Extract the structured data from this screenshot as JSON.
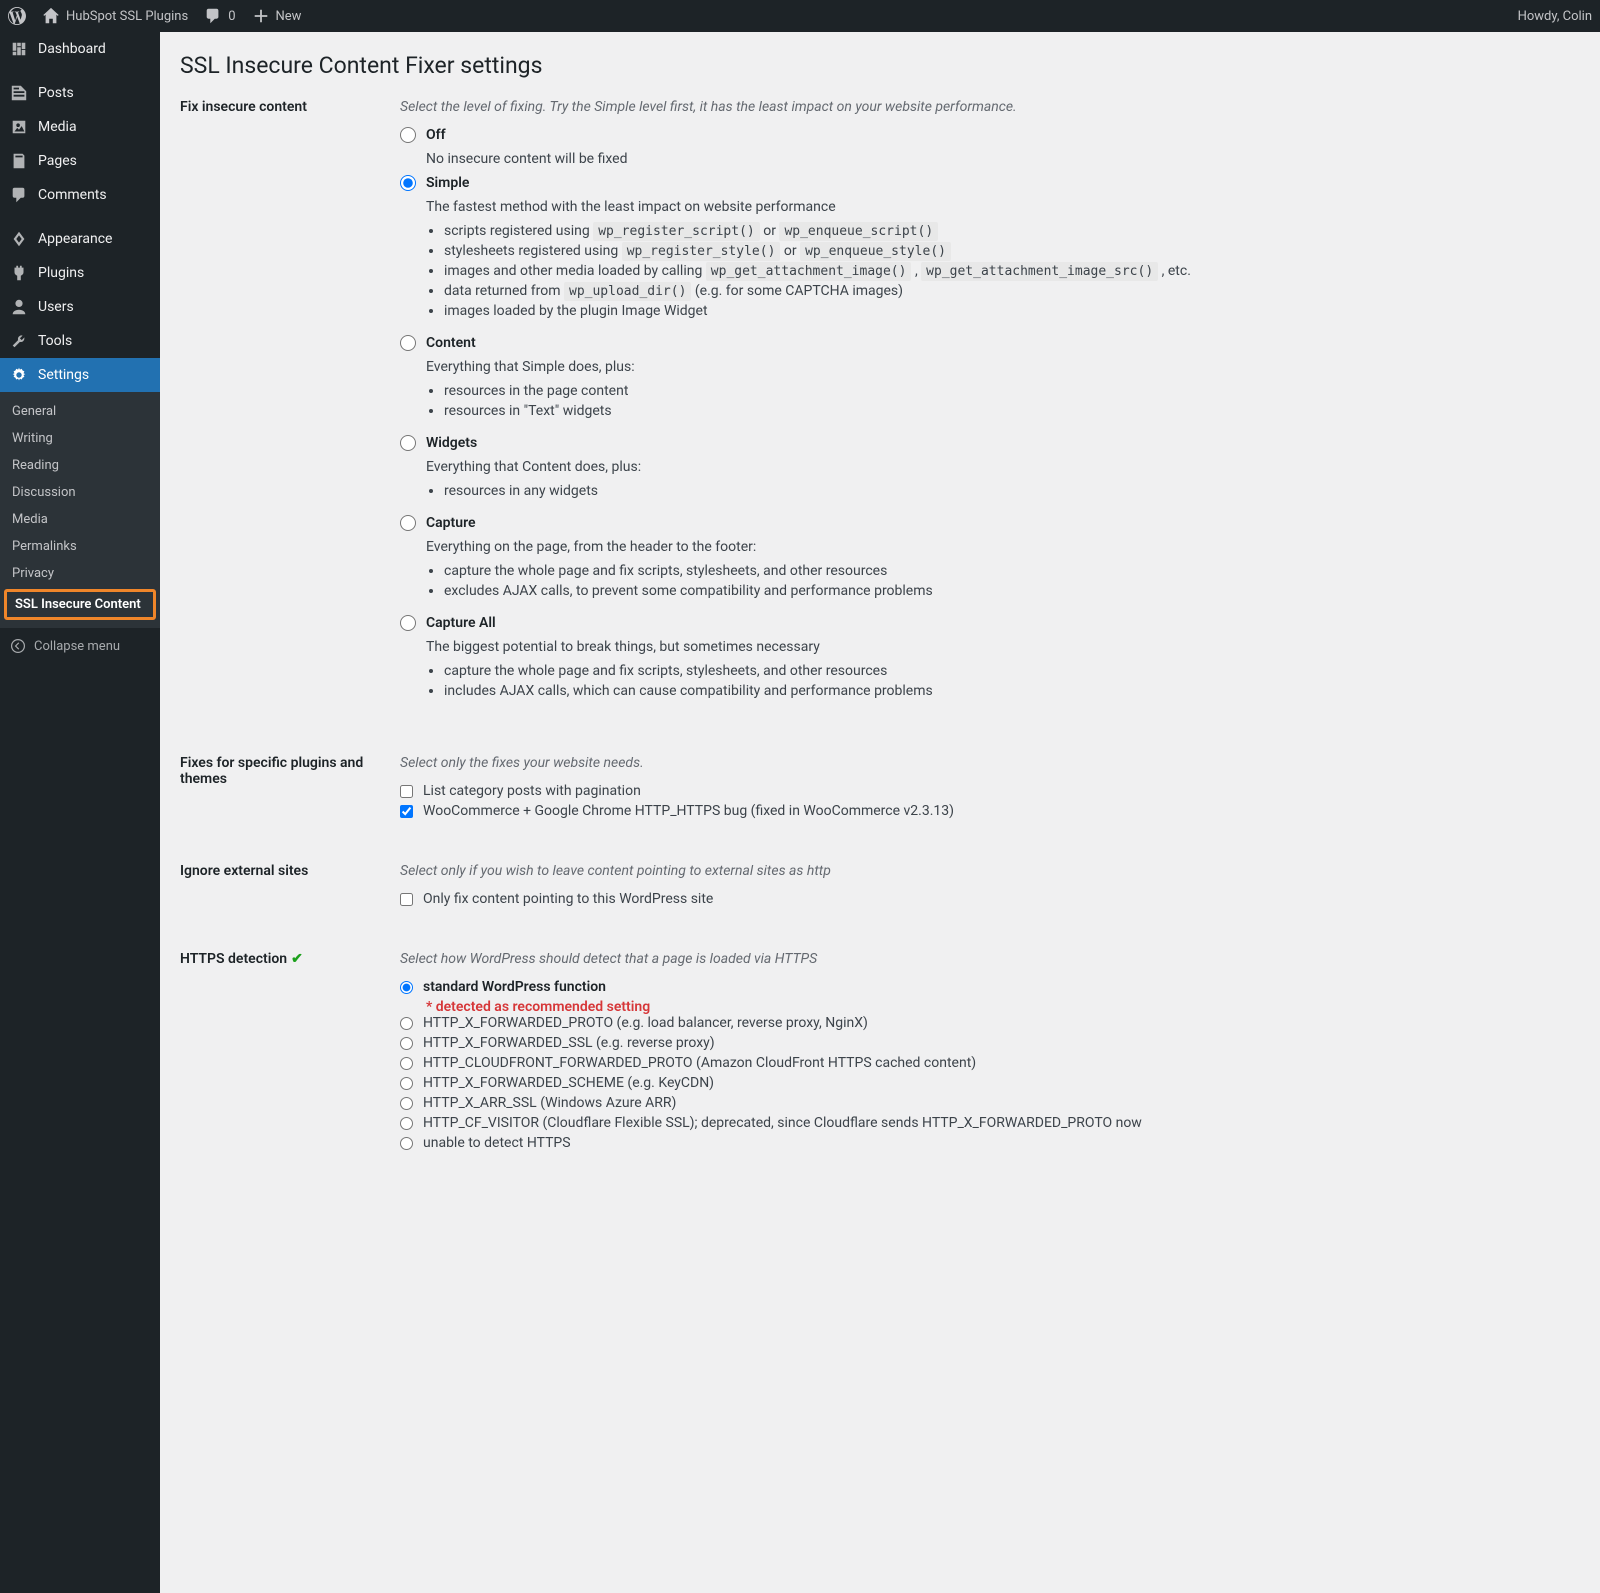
{
  "adminbar": {
    "site_name": "HubSpot SSL Plugins",
    "comment_count": "0",
    "new_label": "New",
    "howdy": "Howdy, Colin"
  },
  "sidebar": {
    "dashboard": "Dashboard",
    "posts": "Posts",
    "media": "Media",
    "pages": "Pages",
    "comments": "Comments",
    "appearance": "Appearance",
    "plugins": "Plugins",
    "users": "Users",
    "tools": "Tools",
    "settings": "Settings",
    "collapse": "Collapse menu",
    "submenu": {
      "general": "General",
      "writing": "Writing",
      "reading": "Reading",
      "discussion": "Discussion",
      "media": "Media",
      "permalinks": "Permalinks",
      "privacy": "Privacy",
      "ssl": "SSL Insecure Content"
    }
  },
  "page": {
    "title": "SSL Insecure Content Fixer settings"
  },
  "fix": {
    "heading": "Fix insecure content",
    "description": "Select the level of fixing. Try the Simple level first, it has the least impact on your website performance.",
    "off": {
      "label": "Off",
      "desc": "No insecure content will be fixed"
    },
    "simple": {
      "label": "Simple",
      "desc": "The fastest method with the least impact on website performance",
      "l1a": "scripts registered using ",
      "l1b": " or ",
      "c1": "wp_register_script()",
      "c2": "wp_enqueue_script()",
      "l2a": "stylesheets registered using ",
      "l2b": " or ",
      "c3": "wp_register_style()",
      "c4": "wp_enqueue_style()",
      "l3a": "images and other media loaded by calling ",
      "l3b": " , ",
      "l3c": " , etc.",
      "c5": "wp_get_attachment_image()",
      "c6": "wp_get_attachment_image_src()",
      "l4a": "data returned from ",
      "l4b": " (e.g. for some CAPTCHA images)",
      "c7": "wp_upload_dir()",
      "l5": "images loaded by the plugin Image Widget"
    },
    "content": {
      "label": "Content",
      "desc": "Everything that Simple does, plus:",
      "l1": "resources in the page content",
      "l2": "resources in \"Text\" widgets"
    },
    "widgets": {
      "label": "Widgets",
      "desc": "Everything that Content does, plus:",
      "l1": "resources in any widgets"
    },
    "capture": {
      "label": "Capture",
      "desc": "Everything on the page, from the header to the footer:",
      "l1": "capture the whole page and fix scripts, stylesheets, and other resources",
      "l2": "excludes AJAX calls, to prevent some compatibility and performance problems"
    },
    "captureall": {
      "label": "Capture All",
      "desc": "The biggest potential to break things, but sometimes necessary",
      "l1": "capture the whole page and fix scripts, stylesheets, and other resources",
      "l2": "includes AJAX calls, which can cause compatibility and performance problems"
    }
  },
  "fixes_specific": {
    "heading": "Fixes for specific plugins and themes",
    "description": "Select only the fixes your website needs.",
    "lcp": "List category posts with pagination",
    "woo": "WooCommerce + Google Chrome HTTP_HTTPS bug (fixed in WooCommerce v2.3.13)"
  },
  "ignore": {
    "heading": "Ignore external sites",
    "description": "Select only if you wish to leave content pointing to external sites as http",
    "only": "Only fix content pointing to this WordPress site"
  },
  "https": {
    "heading": "HTTPS detection",
    "description": "Select how WordPress should detect that a page is loaded via HTTPS",
    "standard": "standard WordPress function",
    "detected": "* detected as recommended setting",
    "proto": "HTTP_X_FORWARDED_PROTO (e.g. load balancer, reverse proxy, NginX)",
    "ssl": "HTTP_X_FORWARDED_SSL (e.g. reverse proxy)",
    "cloudfront": "HTTP_CLOUDFRONT_FORWARDED_PROTO (Amazon CloudFront HTTPS cached content)",
    "scheme": "HTTP_X_FORWARDED_SCHEME (e.g. KeyCDN)",
    "arr": "HTTP_X_ARR_SSL (Windows Azure ARR)",
    "cf": "HTTP_CF_VISITOR (Cloudflare Flexible SSL); deprecated, since Cloudflare sends HTTP_X_FORWARDED_PROTO now",
    "unable": "unable to detect HTTPS"
  }
}
